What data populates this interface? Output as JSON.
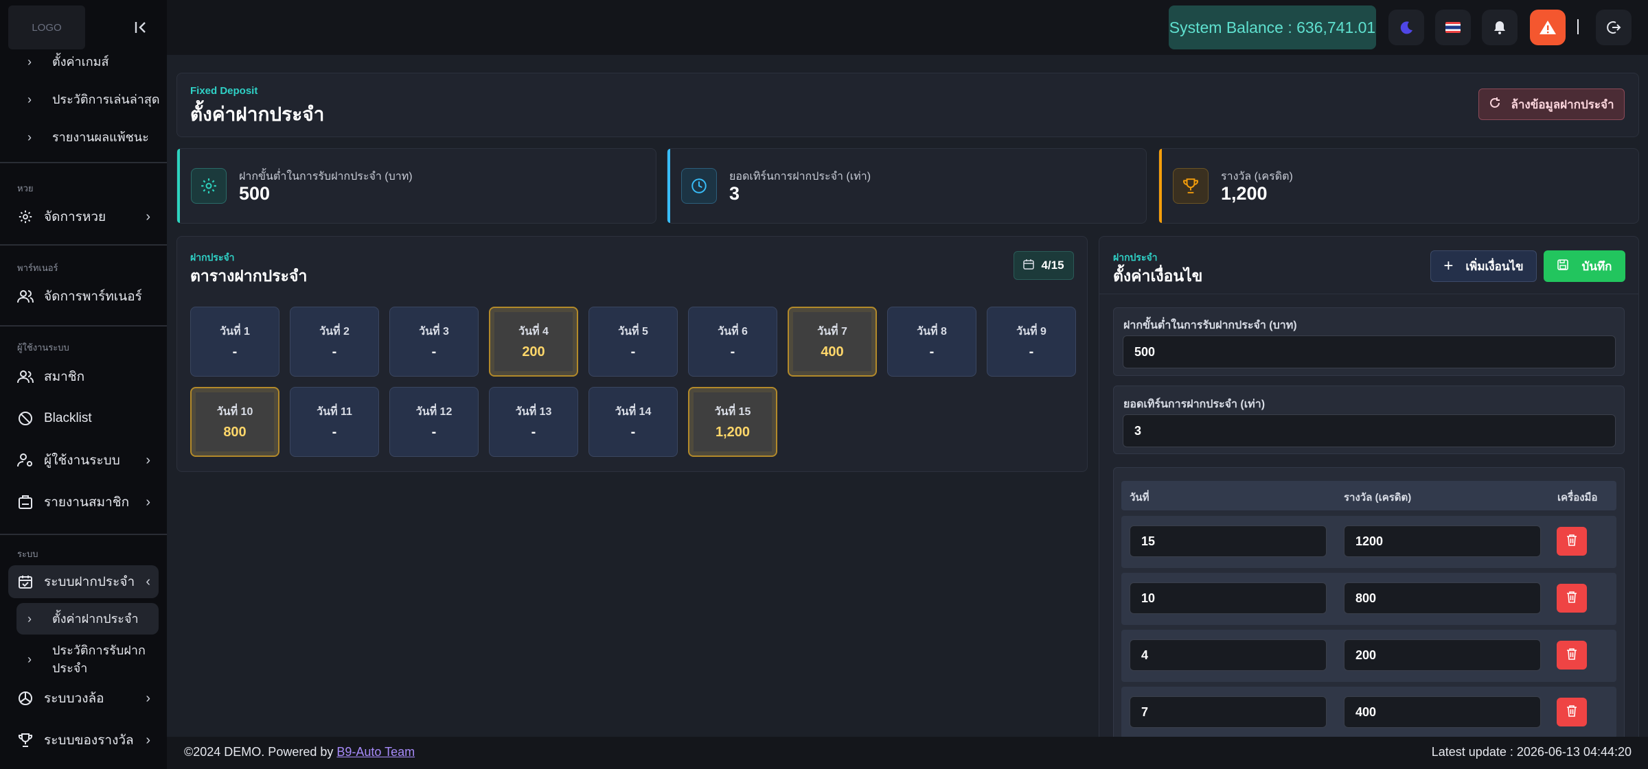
{
  "app": {
    "logo_text": "LOGO",
    "collapse_glyph": "|<"
  },
  "sidebar": {
    "sub_top": [
      {
        "label": "ตั้งค่าเกมส์"
      },
      {
        "label": "ประวัติการเล่นล่าสุด"
      },
      {
        "label": "รายงานผลแพ้ชนะ"
      }
    ],
    "section_lottery": "หวย",
    "lottery_manage": "จัดการหวย",
    "section_partner": "พาร์ทเนอร์",
    "partner_manage": "จัดการพาร์ทเนอร์",
    "section_users": "ผู้ใช้งานระบบ",
    "members": "สมาชิก",
    "blacklist": "Blacklist",
    "system_users": "ผู้ใช้งานระบบ",
    "member_report": "รายงานสมาชิก",
    "section_system": "ระบบ",
    "fixed_deposit": "ระบบฝากประจำ",
    "fd_settings": "ตั้งค่าฝากประจำ",
    "fd_history": "ประวัติการรับฝากประจำ",
    "wheel": "ระบบวงล้อ",
    "rewards": "ระบบของรางวัล"
  },
  "topbar": {
    "balance_text": "System Balance : 636,741.01",
    "icons": [
      "moon-icon",
      "flag-icon",
      "bell-icon",
      "warning-icon",
      "logout-icon"
    ],
    "separator": "|"
  },
  "header": {
    "eyebrow": "Fixed Deposit",
    "title": "ตั้งค่าฝากประจำ",
    "reset_button": "ล้างข้อมูลฝากประจำ"
  },
  "stats": [
    {
      "label": "ฝากขั้นต่ำในการรับฝากประจำ (บาท)",
      "value": "500",
      "icon": "gear-icon",
      "color": "#2dd4bf"
    },
    {
      "label": "ยอดเทิร์นการฝากประจำ (เท่า)",
      "value": "3",
      "icon": "clock-icon",
      "color": "#38bdf8"
    },
    {
      "label": "รางวัล (เครดิต)",
      "value": "1,200",
      "icon": "trophy-icon",
      "color": "#f59e0b"
    }
  ],
  "schedule": {
    "eyebrow": "ฝากประจำ",
    "title": "ตารางฝากประจำ",
    "progress_text": "4/15",
    "days": [
      {
        "label": "วันที่ 1",
        "value": "-",
        "won": false
      },
      {
        "label": "วันที่ 2",
        "value": "-",
        "won": false
      },
      {
        "label": "วันที่ 3",
        "value": "-",
        "won": false
      },
      {
        "label": "วันที่ 4",
        "value": "200",
        "won": true
      },
      {
        "label": "วันที่ 5",
        "value": "-",
        "won": false
      },
      {
        "label": "วันที่ 6",
        "value": "-",
        "won": false
      },
      {
        "label": "วันที่ 7",
        "value": "400",
        "won": true
      },
      {
        "label": "วันที่ 8",
        "value": "-",
        "won": false
      },
      {
        "label": "วันที่ 9",
        "value": "-",
        "won": false
      },
      {
        "label": "วันที่ 10",
        "value": "800",
        "won": true
      },
      {
        "label": "วันที่ 11",
        "value": "-",
        "won": false
      },
      {
        "label": "วันที่ 12",
        "value": "-",
        "won": false
      },
      {
        "label": "วันที่ 13",
        "value": "-",
        "won": false
      },
      {
        "label": "วันที่ 14",
        "value": "-",
        "won": false
      },
      {
        "label": "วันที่ 15",
        "value": "1,200",
        "won": true
      }
    ]
  },
  "conditions": {
    "eyebrow": "ฝากประจำ",
    "title": "ตั้งค่าเงื่อนไข",
    "add_button": "เพิ่มเงื่อนไข",
    "save_button": "บันทึก",
    "min_label": "ฝากขั้นต่ำในการรับฝากประจำ (บาท)",
    "min_value": "500",
    "turn_label": "ยอดเทิร์นการฝากประจำ (เท่า)",
    "turn_value": "3",
    "table_headers": [
      "วันที่",
      "รางวัล (เครดิต)",
      "เครื่องมือ"
    ],
    "rows": [
      {
        "day": "15",
        "reward": "1200"
      },
      {
        "day": "10",
        "reward": "800"
      },
      {
        "day": "4",
        "reward": "200"
      },
      {
        "day": "7",
        "reward": "400"
      }
    ]
  },
  "footer": {
    "prefix": "©2024 DEMO. Powered by ",
    "link": "B9-Auto Team",
    "update": "Latest update : 2026-06-13 04:44:20"
  }
}
